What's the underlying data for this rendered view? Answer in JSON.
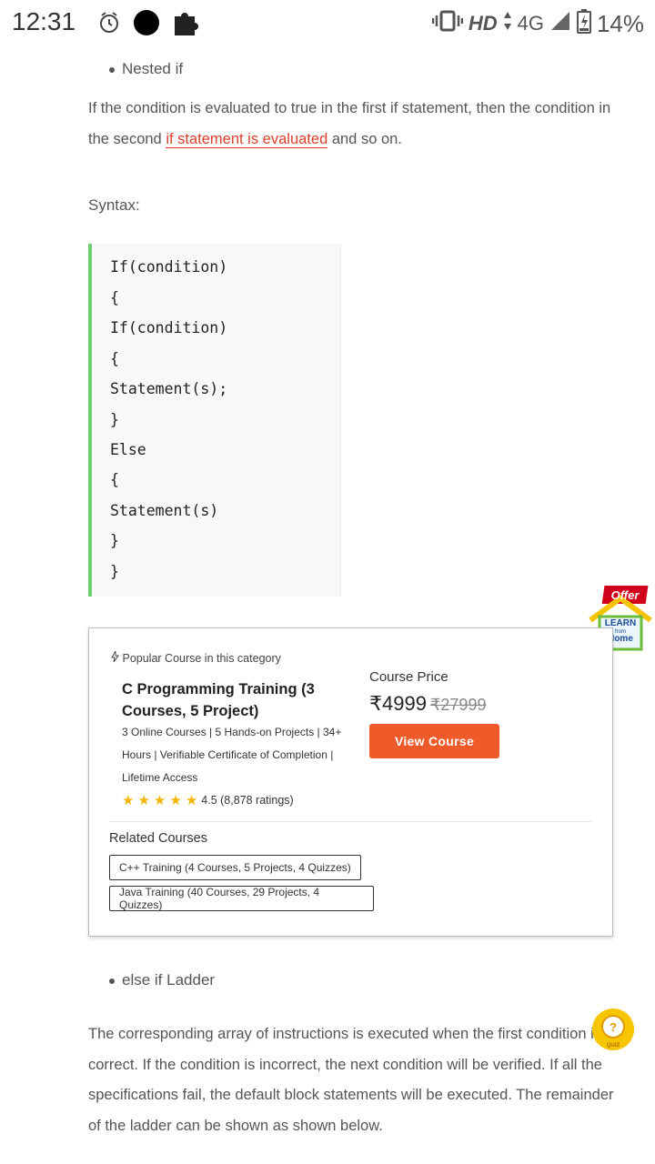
{
  "status_bar": {
    "time": "12:31",
    "network": "HD",
    "network_type": "4G",
    "battery": "14%"
  },
  "content": {
    "bullet_nested": "Nested if",
    "para1_a": "If the condition is evaluated to true in the first if statement, then the condition in the second ",
    "para1_link": "if statement is evaluated",
    "para1_b": " and so on.",
    "syntax_label": "Syntax:",
    "code_lines": [
      "If(condition)",
      "{",
      "If(condition)",
      "{",
      "Statement(s);",
      "}",
      "Else",
      "{",
      "Statement(s)",
      "}",
      "}"
    ],
    "bullet_else": "else if Ladder",
    "para2": "The corresponding array of instructions is executed when the first condition is correct. If the condition is incorrect, the next condition will be verified. If all the specifications fail, the default block statements will be executed. The remainder of the ladder can be shown as shown below."
  },
  "course_box": {
    "popular": "Popular Course in this category",
    "title": "C Programming Training (3 Courses, 5 Project)",
    "description": "3 Online Courses | 5 Hands-on Projects | 34+ Hours | Verifiable Certificate of Completion | Lifetime Access",
    "rating_stars": 4.5,
    "rating_text": "4.5 (8,878 ratings)",
    "price_label": "Course Price",
    "price": "₹4999",
    "old_price": "₹27999",
    "view_button": "View Course",
    "related_label": "Related Courses",
    "related": [
      "C++ Training (4 Courses, 5 Projects, 4 Quizzes)",
      "Java Training (40 Courses, 29 Projects, 4 Quizzes)"
    ]
  },
  "badges": {
    "offer": "Offer",
    "learn": "LEARN",
    "from": "from",
    "home": "Home",
    "quiz": "QUIZ"
  },
  "colors": {
    "link": "#d9412c",
    "button": "#ef5a2a",
    "code_border": "#6fcf6f",
    "star": "#f2b600"
  }
}
